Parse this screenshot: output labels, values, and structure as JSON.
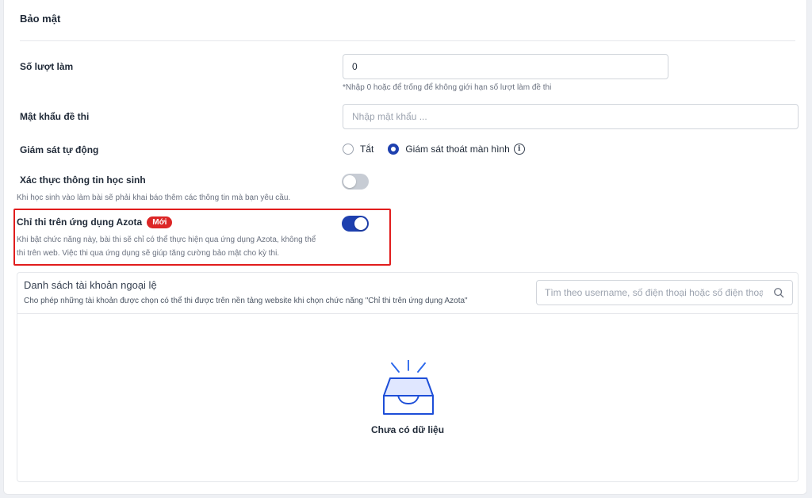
{
  "section": {
    "title": "Bảo mật"
  },
  "attempts": {
    "label": "Số lượt làm",
    "value": "0",
    "hint": "*Nhập 0 hoặc để trống để không giới hạn số lượt làm đề thi"
  },
  "password": {
    "label": "Mật khẩu đề thi",
    "placeholder": "Nhập mật khẩu ..."
  },
  "monitoring": {
    "label": "Giám sát tự động",
    "options": [
      {
        "label": "Tắt",
        "checked": false
      },
      {
        "label": "Giám sát thoát màn hình",
        "checked": true
      }
    ],
    "info_icon": "info-icon"
  },
  "student_verification": {
    "label": "Xác thực thông tin học sinh",
    "description": "Khi học sinh vào làm bài sẽ phải khai báo thêm các thông tin mà bạn yêu cầu.",
    "enabled": false
  },
  "azota_only": {
    "label": "Chỉ thi trên ứng dụng Azota",
    "badge": "Mới",
    "description_line1": "Khi bật chức năng này, bài thi sẽ chỉ có thể thực hiện qua ứng dụng Azota, không thể",
    "description_line2": "thi trên web. Việc thi qua ứng dụng sẽ giúp tăng cường bảo mật cho kỳ thi.",
    "enabled": true
  },
  "exceptions": {
    "title": "Danh sách tài khoản ngoại lệ",
    "description": "Cho phép những tài khoản được chọn có thể thi được trên nền tảng website khi chọn chức năng \"Chỉ thi trên ứng dụng Azota\"",
    "search_placeholder": "Tìm theo username, số điện thoại hoặc số điện thoại phụ huynh",
    "empty_text": "Chưa có dữ liệu"
  },
  "colors": {
    "primary": "#1e40af",
    "highlight_border": "#e11d1d",
    "badge": "#dc2626"
  }
}
